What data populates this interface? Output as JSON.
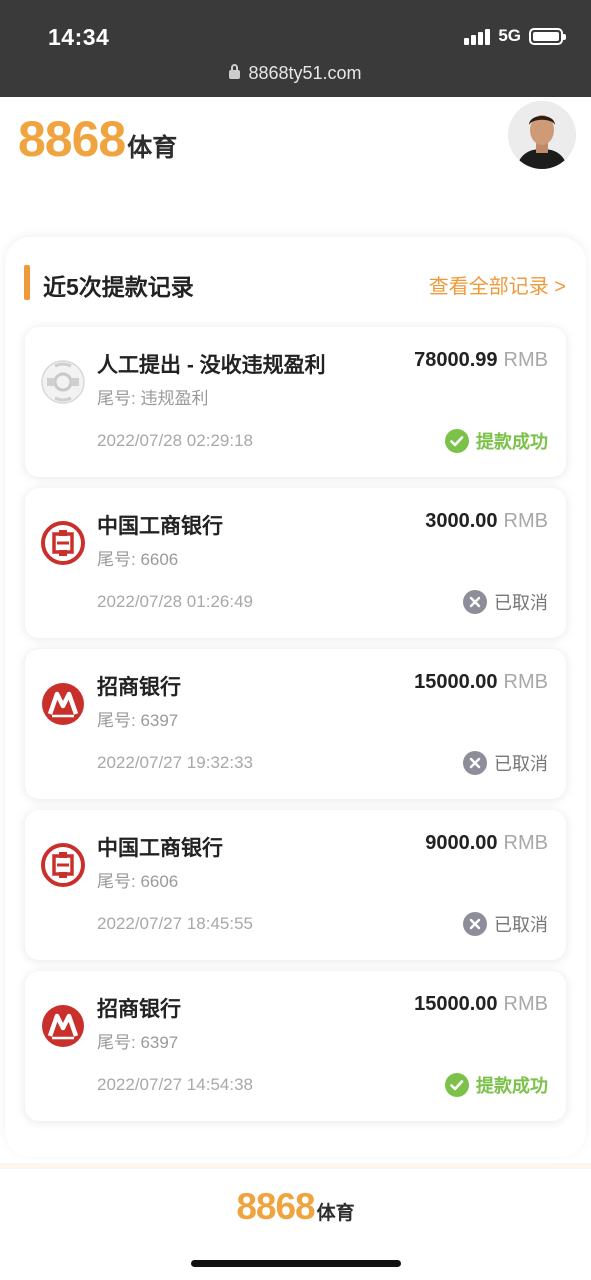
{
  "status_bar": {
    "time": "14:34",
    "network": "5G",
    "url": "8868ty51.com"
  },
  "header": {
    "brand_number": "8868",
    "brand_text": "体育"
  },
  "section": {
    "title": "近5次提款记录",
    "view_all": "查看全部记录 >"
  },
  "records": [
    {
      "icon": "manual-withdraw-icon",
      "name": "人工提出 - 没收违规盈利",
      "tail": "尾号: 违规盈利",
      "amount": "78000.99",
      "currency": "RMB",
      "datetime": "2022/07/28 02:29:18",
      "status": "提款成功",
      "status_type": "success"
    },
    {
      "icon": "icbc-logo-icon",
      "name": "中国工商银行",
      "tail": "尾号: 6606",
      "amount": "3000.00",
      "currency": "RMB",
      "datetime": "2022/07/28 01:26:49",
      "status": "已取消",
      "status_type": "cancelled"
    },
    {
      "icon": "cmb-logo-icon",
      "name": "招商银行",
      "tail": "尾号: 6397",
      "amount": "15000.00",
      "currency": "RMB",
      "datetime": "2022/07/27 19:32:33",
      "status": "已取消",
      "status_type": "cancelled"
    },
    {
      "icon": "icbc-logo-icon",
      "name": "中国工商银行",
      "tail": "尾号: 6606",
      "amount": "9000.00",
      "currency": "RMB",
      "datetime": "2022/07/27 18:45:55",
      "status": "已取消",
      "status_type": "cancelled"
    },
    {
      "icon": "cmb-logo-icon",
      "name": "招商银行",
      "tail": "尾号: 6397",
      "amount": "15000.00",
      "currency": "RMB",
      "datetime": "2022/07/27 14:54:38",
      "status": "提款成功",
      "status_type": "success"
    }
  ],
  "footer": {
    "brand_number": "8868",
    "brand_text": "体育"
  },
  "colors": {
    "brand_orange": "#f0a440",
    "success_green": "#7cc24a",
    "cancel_gray": "#8e8e9a",
    "bank_red": "#c9302c"
  }
}
